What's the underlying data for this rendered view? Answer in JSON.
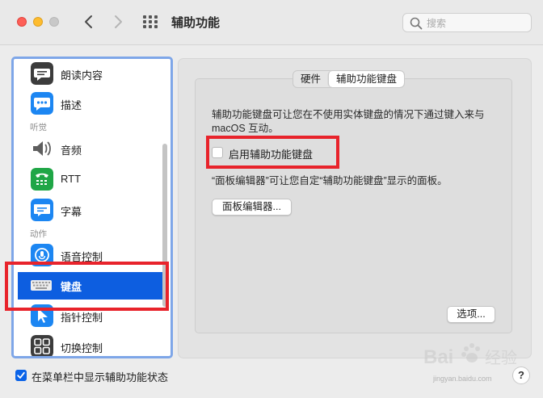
{
  "window": {
    "title": "辅助功能"
  },
  "search": {
    "placeholder": "搜索"
  },
  "sidebar": {
    "items": [
      {
        "label": "朗读内容",
        "icon": "speech-bubble-icon",
        "color": "#3c3c3c"
      },
      {
        "label": "描述",
        "icon": "comment-dots-icon",
        "color": "#1c86f2"
      },
      {
        "section": "听觉"
      },
      {
        "label": "音频",
        "icon": "speaker-icon",
        "color": "#5e5e5e"
      },
      {
        "label": "RTT",
        "icon": "phone-keyboard-icon",
        "color": "#1fa646"
      },
      {
        "label": "字幕",
        "icon": "caption-icon",
        "color": "#1c86f2"
      },
      {
        "section": "动作"
      },
      {
        "label": "语音控制",
        "icon": "voice-control-icon",
        "color": "#1c86f2"
      },
      {
        "label": "键盘",
        "icon": "keyboard-icon",
        "color": "#e9e9e9",
        "selected": true
      },
      {
        "label": "指针控制",
        "icon": "pointer-icon",
        "color": "#1c86f2"
      },
      {
        "label": "切换控制",
        "icon": "switch-control-icon",
        "color": "#3c3c3c"
      }
    ]
  },
  "tabs": [
    {
      "label": "硬件",
      "active": false
    },
    {
      "label": "辅助功能键盘",
      "active": true
    }
  ],
  "content": {
    "description": "辅助功能键盘可让您在不使用实体键盘的情况下通过键入来与 macOS 互动。",
    "checkbox_label": "启用辅助功能键盘",
    "checkbox_checked": false,
    "panel_editor_text": "“面板编辑器”可让您自定“辅助功能键盘”显示的面板。",
    "panel_editor_button": "面板编辑器...",
    "options_button": "选项..."
  },
  "footer": {
    "show_in_menubar_label": "在菜单栏中显示辅助功能状态",
    "show_in_menubar_checked": true,
    "help_label": "?"
  },
  "watermark": {
    "text": "jingyan.baidu.com"
  },
  "colors": {
    "accent": "#0d5ee0",
    "annotation": "#e8232b"
  }
}
